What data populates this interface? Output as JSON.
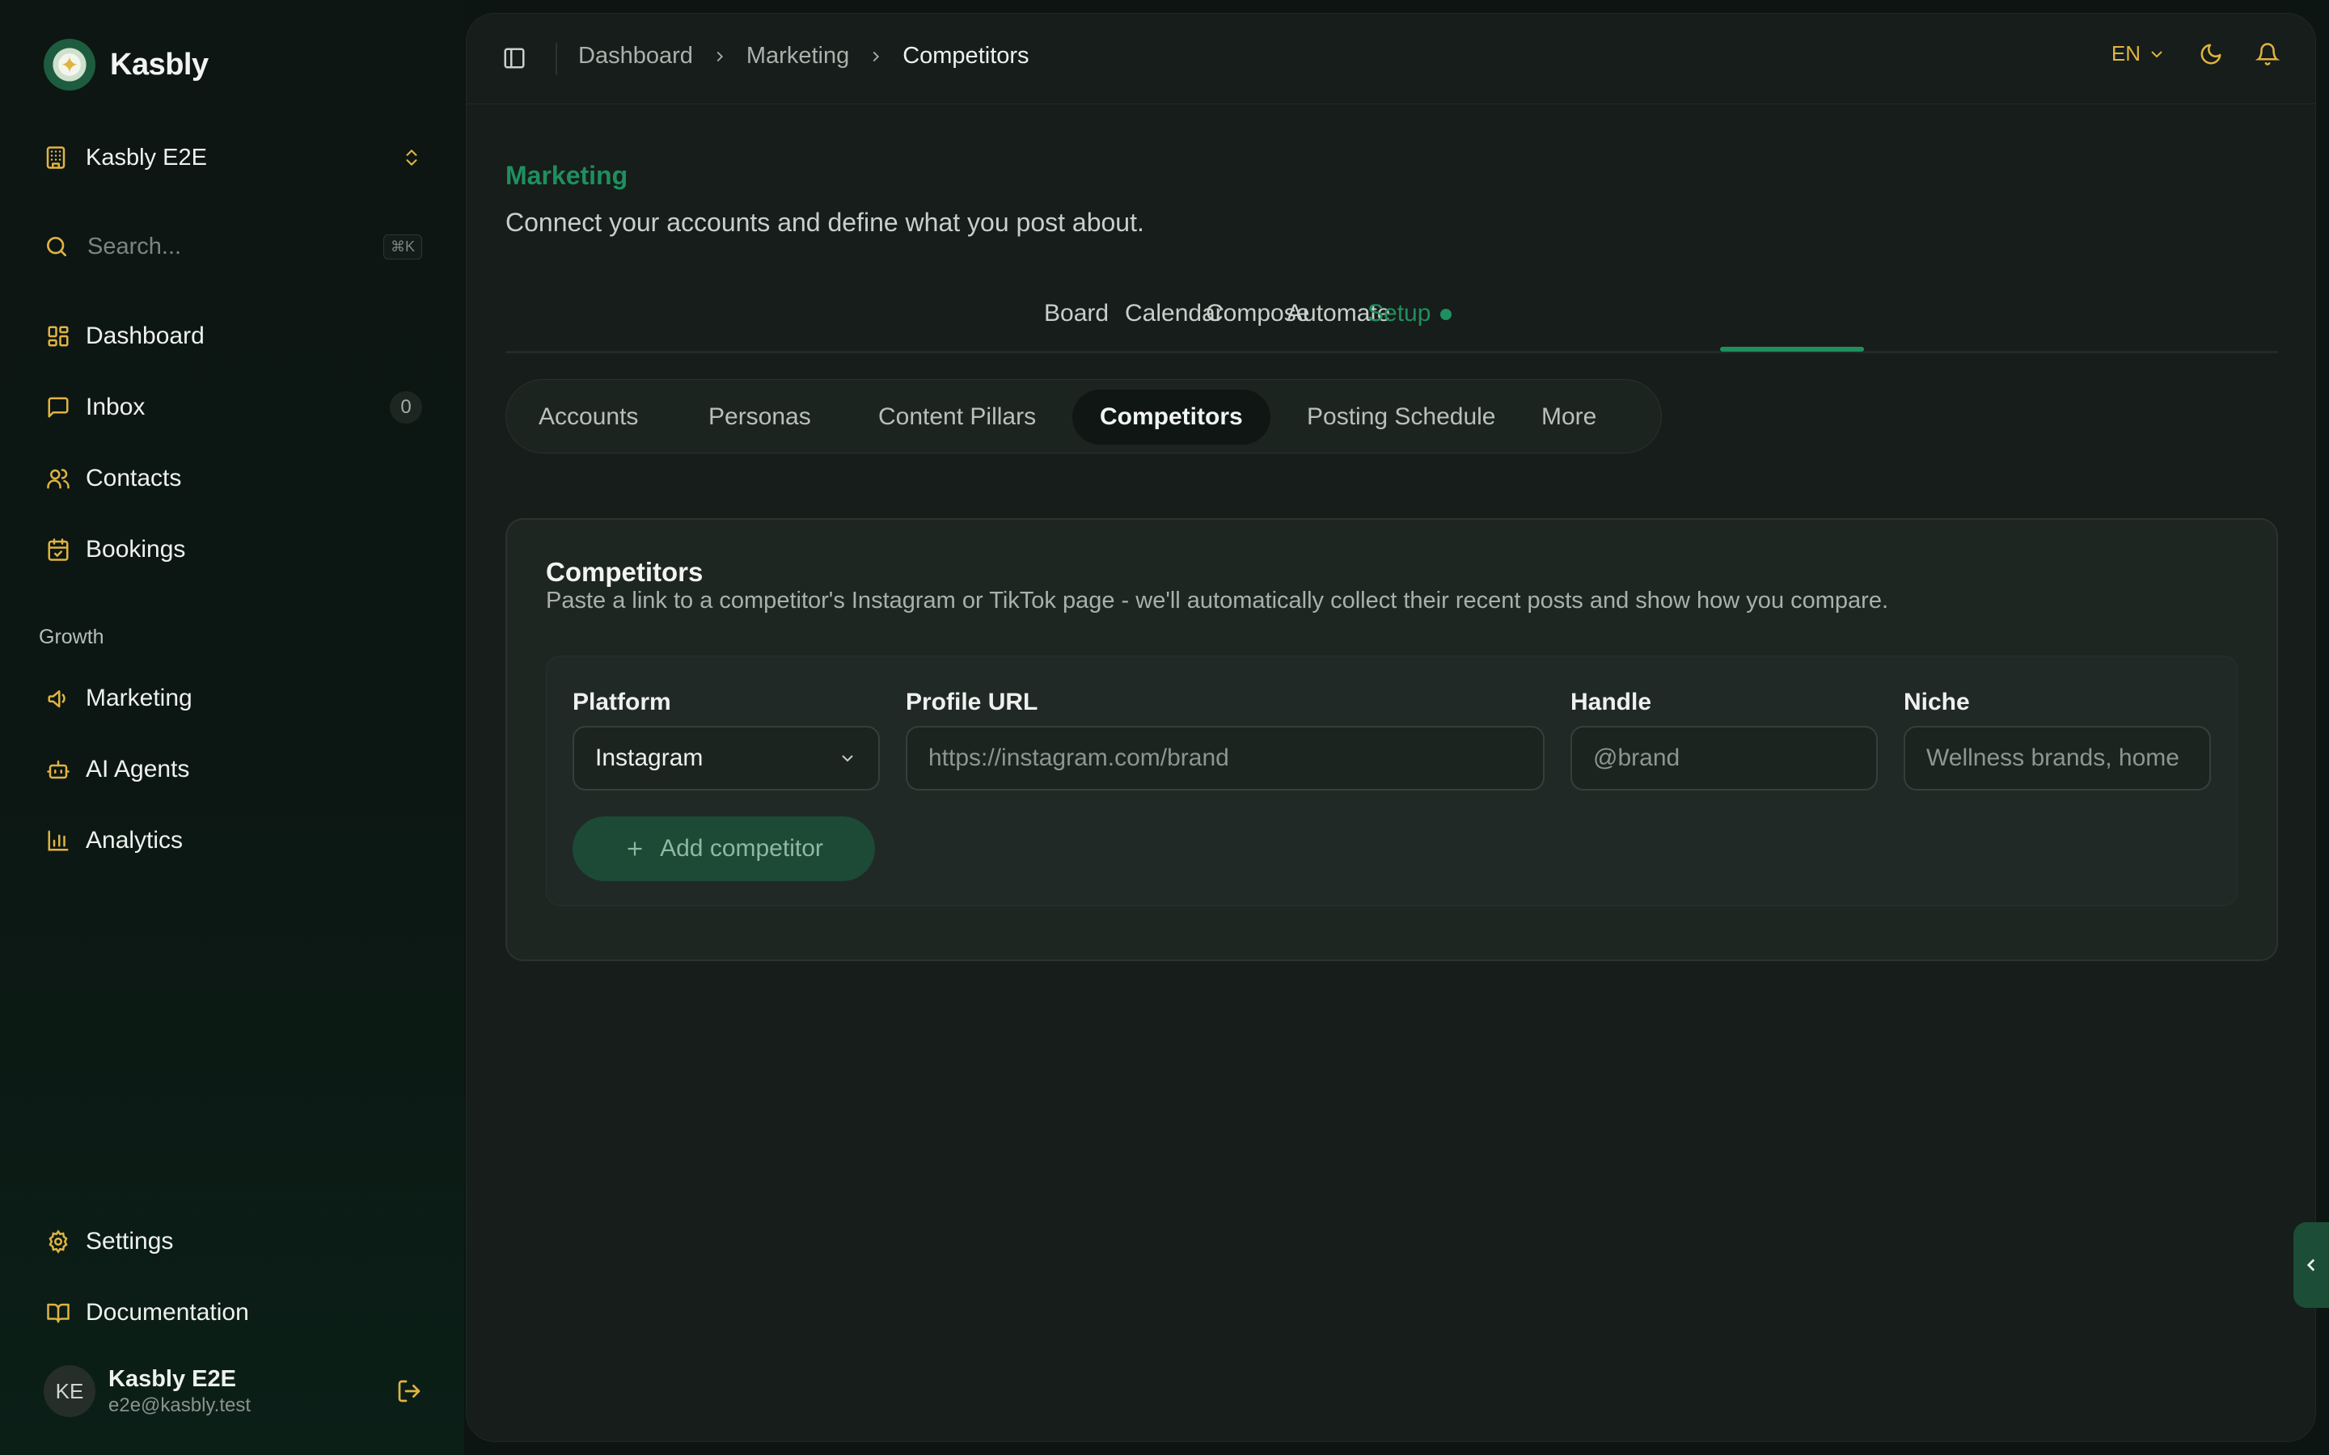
{
  "brand": {
    "name": "Kasbly"
  },
  "org": {
    "name": "Kasbly E2E"
  },
  "search": {
    "placeholder": "Search...",
    "shortcut": "⌘K"
  },
  "nav": {
    "main": [
      {
        "label": "Dashboard",
        "icon": "layout-grid-icon"
      },
      {
        "label": "Inbox",
        "icon": "message-square-icon",
        "badge": "0"
      },
      {
        "label": "Contacts",
        "icon": "users-icon"
      },
      {
        "label": "Bookings",
        "icon": "calendar-check-icon"
      }
    ],
    "growth_label": "Growth",
    "growth": [
      {
        "label": "Marketing",
        "icon": "megaphone-icon"
      },
      {
        "label": "AI Agents",
        "icon": "bot-icon"
      },
      {
        "label": "Analytics",
        "icon": "bar-chart-icon"
      }
    ],
    "bottom": [
      {
        "label": "Settings",
        "icon": "gear-icon"
      },
      {
        "label": "Documentation",
        "icon": "book-open-icon"
      }
    ]
  },
  "user": {
    "initials": "KE",
    "name": "Kasbly E2E",
    "email": "e2e@kasbly.test"
  },
  "breadcrumb": [
    "Dashboard",
    "Marketing",
    "Competitors"
  ],
  "topbar": {
    "language": "EN"
  },
  "page": {
    "eyebrow": "Marketing",
    "subtitle": "Connect your accounts and define what you post about."
  },
  "tabs": [
    "Board",
    "Calendar",
    "Compose",
    "Automate",
    "Setup"
  ],
  "active_tab": "Setup",
  "subtabs": [
    "Accounts",
    "Personas",
    "Content Pillars",
    "Competitors",
    "Posting Schedule",
    "More"
  ],
  "active_subtab": "Competitors",
  "card": {
    "title": "Competitors",
    "description": "Paste a link to a competitor's Instagram or TikTok page - we'll automatically collect their recent posts and show how you compare."
  },
  "form": {
    "platform_label": "Platform",
    "platform_value": "Instagram",
    "url_label": "Profile URL",
    "url_placeholder": "https://instagram.com/brand",
    "handle_label": "Handle",
    "handle_placeholder": "@brand",
    "niche_label": "Niche",
    "niche_placeholder": "Wellness brands, home",
    "add_button": "Add competitor"
  },
  "colors": {
    "accent": "#1f8f5f",
    "icon": "#e0b342",
    "background": "#0c1512",
    "panel": "#161d1a"
  }
}
